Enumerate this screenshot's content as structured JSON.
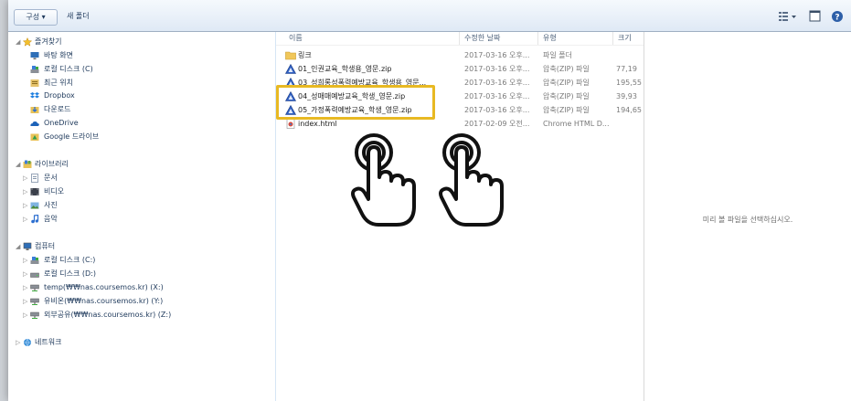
{
  "toolbar": {
    "organize_label": "구성 ▾",
    "new_folder_label": "새 폴더",
    "icons": [
      "view-options-icon",
      "preview-pane-icon",
      "help-icon"
    ]
  },
  "sidebar": {
    "favorites": {
      "label": "즐겨찾기",
      "items": [
        {
          "label": "바탕 화면",
          "icon": "desktop-icon"
        },
        {
          "label": "로컬 디스크 (C)",
          "icon": "drive-icon"
        },
        {
          "label": "최근 위치",
          "icon": "recent-places-icon"
        },
        {
          "label": "Dropbox",
          "icon": "dropbox-icon"
        },
        {
          "label": "다운로드",
          "icon": "downloads-icon"
        },
        {
          "label": "OneDrive",
          "icon": "onedrive-icon"
        },
        {
          "label": "Google 드라이브",
          "icon": "google-drive-icon"
        }
      ]
    },
    "libraries": {
      "label": "라이브러리",
      "items": [
        {
          "label": "문서",
          "icon": "documents-icon"
        },
        {
          "label": "비디오",
          "icon": "videos-icon"
        },
        {
          "label": "사진",
          "icon": "pictures-icon"
        },
        {
          "label": "음악",
          "icon": "music-icon"
        }
      ]
    },
    "computer": {
      "label": "컴퓨터",
      "items": [
        {
          "label": "로컬 디스크 (C:)",
          "icon": "drive-icon"
        },
        {
          "label": "로컬 디스크 (D:)",
          "icon": "drive-icon"
        },
        {
          "label": "temp(₩₩nas.coursemos.kr) (X:)",
          "icon": "network-drive-icon"
        },
        {
          "label": "유비온(₩₩nas.coursemos.kr) (Y:)",
          "icon": "network-drive-icon"
        },
        {
          "label": "외부공유(₩₩nas.coursemos.kr) (Z:)",
          "icon": "network-drive-icon"
        }
      ]
    },
    "network": {
      "label": "네트워크"
    }
  },
  "columns": {
    "name": "이름",
    "date": "수정한 날짜",
    "type": "유형",
    "size": "크기"
  },
  "files": [
    {
      "name": "링크",
      "date": "2017-03-16 오후...",
      "type": "파일 폴더",
      "size": "",
      "icon": "folder-icon"
    },
    {
      "name": "01_인권교육_학생용_영문.zip",
      "date": "2017-03-16 오후...",
      "type": "압축(ZIP) 파일",
      "size": "77,19",
      "icon": "zip-file-icon"
    },
    {
      "name": "03_성희롱성폭력예방교육_학생용_영문...",
      "date": "2017-03-16 오후...",
      "type": "압축(ZIP) 파일",
      "size": "195,55",
      "icon": "zip-file-icon"
    },
    {
      "name": "04_성매매예방교육_학생_영문.zip",
      "date": "2017-03-16 오후...",
      "type": "압축(ZIP) 파일",
      "size": "39,93",
      "icon": "zip-file-icon"
    },
    {
      "name": "05_가정폭력예방교육_학생_영문.zip",
      "date": "2017-03-16 오후...",
      "type": "압축(ZIP) 파일",
      "size": "194,65",
      "icon": "zip-file-icon"
    },
    {
      "name": "index.html",
      "date": "2017-02-09 오전...",
      "type": "Chrome HTML D...",
      "size": "",
      "icon": "html-file-icon"
    }
  ],
  "preview": {
    "message": "미리 볼 파일을 선택하십시오."
  },
  "colors": {
    "highlight": "#e8b923",
    "accent": "#1e395b"
  }
}
